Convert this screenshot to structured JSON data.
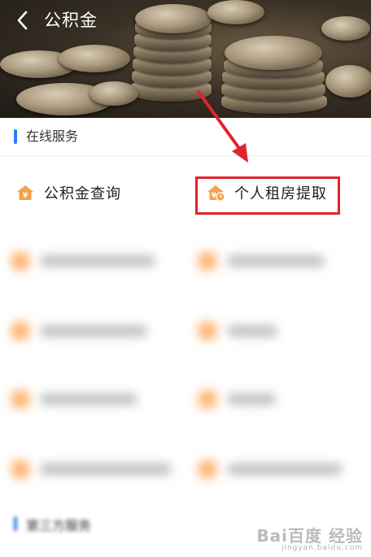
{
  "header": {
    "title": "公积金",
    "back_icon": "chevron-left-icon"
  },
  "section": {
    "title": "在线服务"
  },
  "services": [
    {
      "label": "公积金查询",
      "icon": "house-yen-icon"
    },
    {
      "label": "个人租房提取",
      "icon": "house-yen-clock-icon"
    }
  ],
  "annotation": {
    "box_color": "#e1232e",
    "arrow_color": "#e1232e"
  },
  "bottom_section": {
    "title": "第三方服务"
  },
  "watermark": {
    "text": "Bai百度 经验",
    "sub": "jingyan.baidu.com"
  },
  "colors": {
    "accent": "#2f7cf6",
    "icon_orange": "#f5a14a"
  }
}
